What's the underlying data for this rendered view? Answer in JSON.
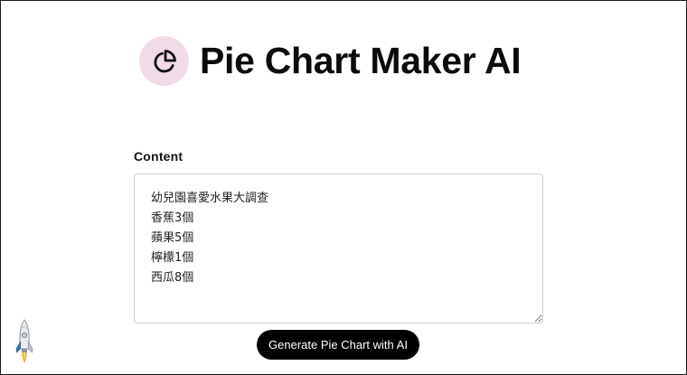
{
  "app": {
    "title": "Pie Chart Maker AI",
    "logo_icon": "pie-chart-icon",
    "logo_bg_color": "#f1dbe8"
  },
  "form": {
    "content_label": "Content",
    "content_value": "幼兒園喜愛水果大調查\n香蕉3個\n蘋果5個\n檸檬1個\n西瓜8個",
    "generate_label": "Generate Pie Chart with AI",
    "button_color": "#000000"
  },
  "decor": {
    "corner_icon": "rocket-icon"
  }
}
